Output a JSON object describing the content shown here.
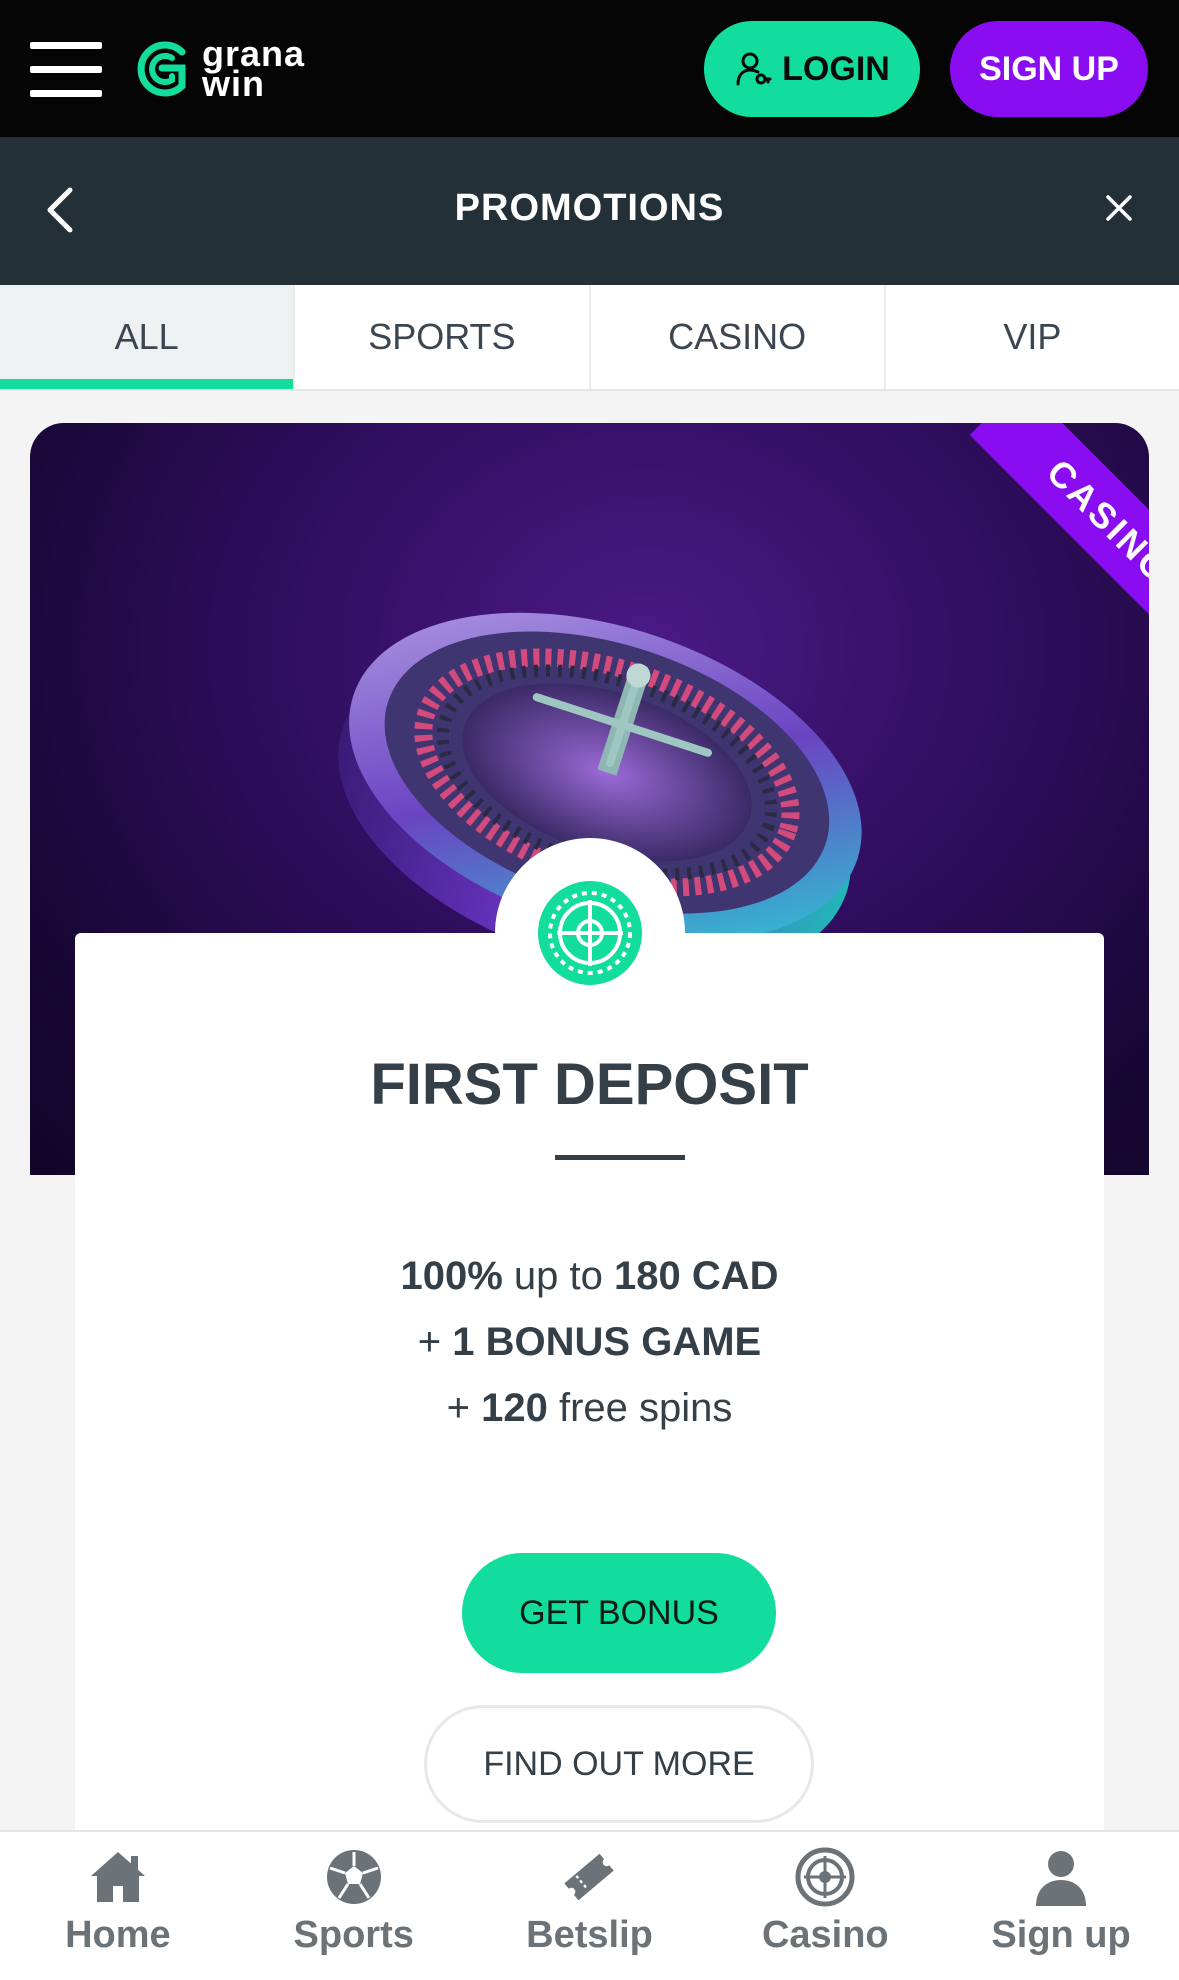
{
  "header": {
    "logo_line1": "grana",
    "logo_line2": "win",
    "login_label": "LOGIN",
    "signup_label": "SIGN UP"
  },
  "promo_bar": {
    "title": "PROMOTIONS"
  },
  "tabs": [
    {
      "label": "ALL",
      "active": true
    },
    {
      "label": "SPORTS",
      "active": false
    },
    {
      "label": "CASINO",
      "active": false
    },
    {
      "label": "VIP",
      "active": false
    }
  ],
  "promo_card": {
    "ribbon": "CASINO",
    "title": "FIRST DEPOSIT",
    "line1_bold_a": "100%",
    "line1_text": " up to ",
    "line1_bold_b": "180 CAD",
    "line2_text": "+ ",
    "line2_bold": "1 BONUS GAME",
    "line3_text": "+ ",
    "line3_bold": "120",
    "line3_tail": " free spins",
    "get_bonus_label": "GET BONUS",
    "find_more_label": "FIND OUT MORE"
  },
  "bottom_nav": [
    {
      "label": "Home",
      "icon": "home-icon"
    },
    {
      "label": "Sports",
      "icon": "soccer-ball-icon"
    },
    {
      "label": "Betslip",
      "icon": "ticket-icon"
    },
    {
      "label": "Casino",
      "icon": "roulette-icon"
    },
    {
      "label": "Sign up",
      "icon": "user-icon"
    }
  ],
  "colors": {
    "accent_green": "#12dd9c",
    "accent_purple": "#8a0cf0",
    "header_bg": "#050505",
    "promo_bar_bg": "#233038",
    "text_dark": "#343f48"
  }
}
